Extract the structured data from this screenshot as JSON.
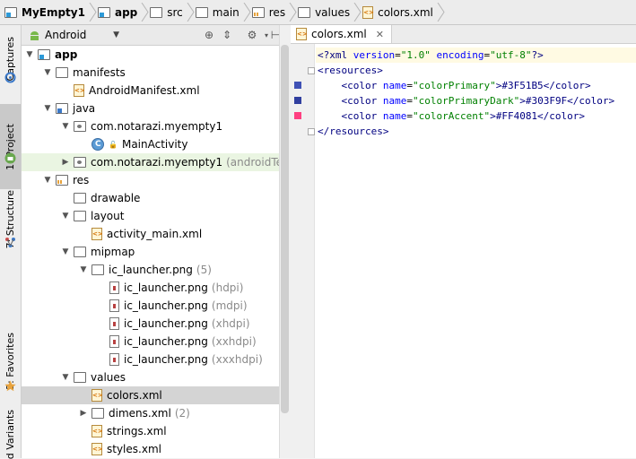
{
  "breadcrumb": [
    {
      "label": "MyEmpty1",
      "icon": "module-folder-icon",
      "bold": true
    },
    {
      "label": "app",
      "icon": "module-folder-icon",
      "bold": true
    },
    {
      "label": "src",
      "icon": "folder-icon",
      "bold": false
    },
    {
      "label": "main",
      "icon": "folder-icon",
      "bold": false
    },
    {
      "label": "res",
      "icon": "res-folder-icon",
      "bold": false
    },
    {
      "label": "values",
      "icon": "folder-icon",
      "bold": false
    },
    {
      "label": "colors.xml",
      "icon": "xml-file-icon",
      "bold": false
    }
  ],
  "side_tabs": {
    "captures": "Captures",
    "project": "1: Project",
    "structure": "7: Structure",
    "favorites": "2: Favorites",
    "variants": "d Variants"
  },
  "project_panel": {
    "view_selector": "Android",
    "tree": [
      {
        "label": "app",
        "icon": "module",
        "indent": 0,
        "arrow": "down",
        "bold": true
      },
      {
        "label": "manifests",
        "icon": "folder",
        "indent": 1,
        "arrow": "down"
      },
      {
        "label": "AndroidManifest.xml",
        "icon": "xml",
        "indent": 2,
        "arrow": ""
      },
      {
        "label": "java",
        "icon": "java",
        "indent": 1,
        "arrow": "down"
      },
      {
        "label": "com.notarazi.myempty1",
        "icon": "pkg",
        "indent": 2,
        "arrow": "down"
      },
      {
        "label": "MainActivity",
        "icon": "class",
        "indent": 3,
        "arrow": ""
      },
      {
        "label": "com.notarazi.myempty1",
        "icon": "pkg",
        "indent": 2,
        "arrow": "right",
        "suffix": "(androidTest)"
      },
      {
        "label": "res",
        "icon": "res",
        "indent": 1,
        "arrow": "down"
      },
      {
        "label": "drawable",
        "icon": "folder",
        "indent": 2,
        "arrow": ""
      },
      {
        "label": "layout",
        "icon": "folder",
        "indent": 2,
        "arrow": "down"
      },
      {
        "label": "activity_main.xml",
        "icon": "xml",
        "indent": 3,
        "arrow": ""
      },
      {
        "label": "mipmap",
        "icon": "folder",
        "indent": 2,
        "arrow": "down"
      },
      {
        "label": "ic_launcher.png",
        "icon": "folder",
        "indent": 3,
        "arrow": "down",
        "suffix": "(5)"
      },
      {
        "label": "ic_launcher.png",
        "icon": "png",
        "indent": 4,
        "arrow": "",
        "suffix": "(hdpi)"
      },
      {
        "label": "ic_launcher.png",
        "icon": "png",
        "indent": 4,
        "arrow": "",
        "suffix": "(mdpi)"
      },
      {
        "label": "ic_launcher.png",
        "icon": "png",
        "indent": 4,
        "arrow": "",
        "suffix": "(xhdpi)"
      },
      {
        "label": "ic_launcher.png",
        "icon": "png",
        "indent": 4,
        "arrow": "",
        "suffix": "(xxhdpi)"
      },
      {
        "label": "ic_launcher.png",
        "icon": "png",
        "indent": 4,
        "arrow": "",
        "suffix": "(xxxhdpi)"
      },
      {
        "label": "values",
        "icon": "folder",
        "indent": 2,
        "arrow": "down"
      },
      {
        "label": "colors.xml",
        "icon": "xml",
        "indent": 3,
        "arrow": "",
        "selected": true
      },
      {
        "label": "dimens.xml",
        "icon": "folder",
        "indent": 3,
        "arrow": "right",
        "suffix": "(2)"
      },
      {
        "label": "strings.xml",
        "icon": "xml",
        "indent": 3,
        "arrow": ""
      },
      {
        "label": "styles.xml",
        "icon": "xml",
        "indent": 3,
        "arrow": ""
      }
    ]
  },
  "editor": {
    "tab_label": "colors.xml",
    "lines": [
      {
        "parts": [
          {
            "t": "<?xml ",
            "c": "tag"
          },
          {
            "t": "version",
            "c": "attr"
          },
          {
            "t": "=",
            "c": ""
          },
          {
            "t": "\"1.0\"",
            "c": "val"
          },
          {
            "t": " ",
            "c": ""
          },
          {
            "t": "encoding",
            "c": "attr"
          },
          {
            "t": "=",
            "c": ""
          },
          {
            "t": "\"utf-8\"",
            "c": "val"
          },
          {
            "t": "?>",
            "c": "tag"
          }
        ],
        "current": true
      },
      {
        "parts": [
          {
            "t": "<resources>",
            "c": "tag"
          }
        ],
        "fold": true
      },
      {
        "parts": [
          {
            "t": "    <color ",
            "c": "tag"
          },
          {
            "t": "name",
            "c": "attr"
          },
          {
            "t": "=",
            "c": ""
          },
          {
            "t": "\"colorPrimary\"",
            "c": "val"
          },
          {
            "t": ">#3F51B5</color>",
            "c": "tag"
          }
        ],
        "swatch": "#3F51B5"
      },
      {
        "parts": [
          {
            "t": "    <color ",
            "c": "tag"
          },
          {
            "t": "name",
            "c": "attr"
          },
          {
            "t": "=",
            "c": ""
          },
          {
            "t": "\"colorPrimaryDark\"",
            "c": "val"
          },
          {
            "t": ">#303F9F</color>",
            "c": "tag"
          }
        ],
        "swatch": "#303F9F"
      },
      {
        "parts": [
          {
            "t": "    <color ",
            "c": "tag"
          },
          {
            "t": "name",
            "c": "attr"
          },
          {
            "t": "=",
            "c": ""
          },
          {
            "t": "\"colorAccent\"",
            "c": "val"
          },
          {
            "t": ">#FF4081</color>",
            "c": "tag"
          }
        ],
        "swatch": "#FF4081"
      },
      {
        "parts": [
          {
            "t": "</resources>",
            "c": "tag"
          }
        ],
        "fold": true
      }
    ]
  }
}
